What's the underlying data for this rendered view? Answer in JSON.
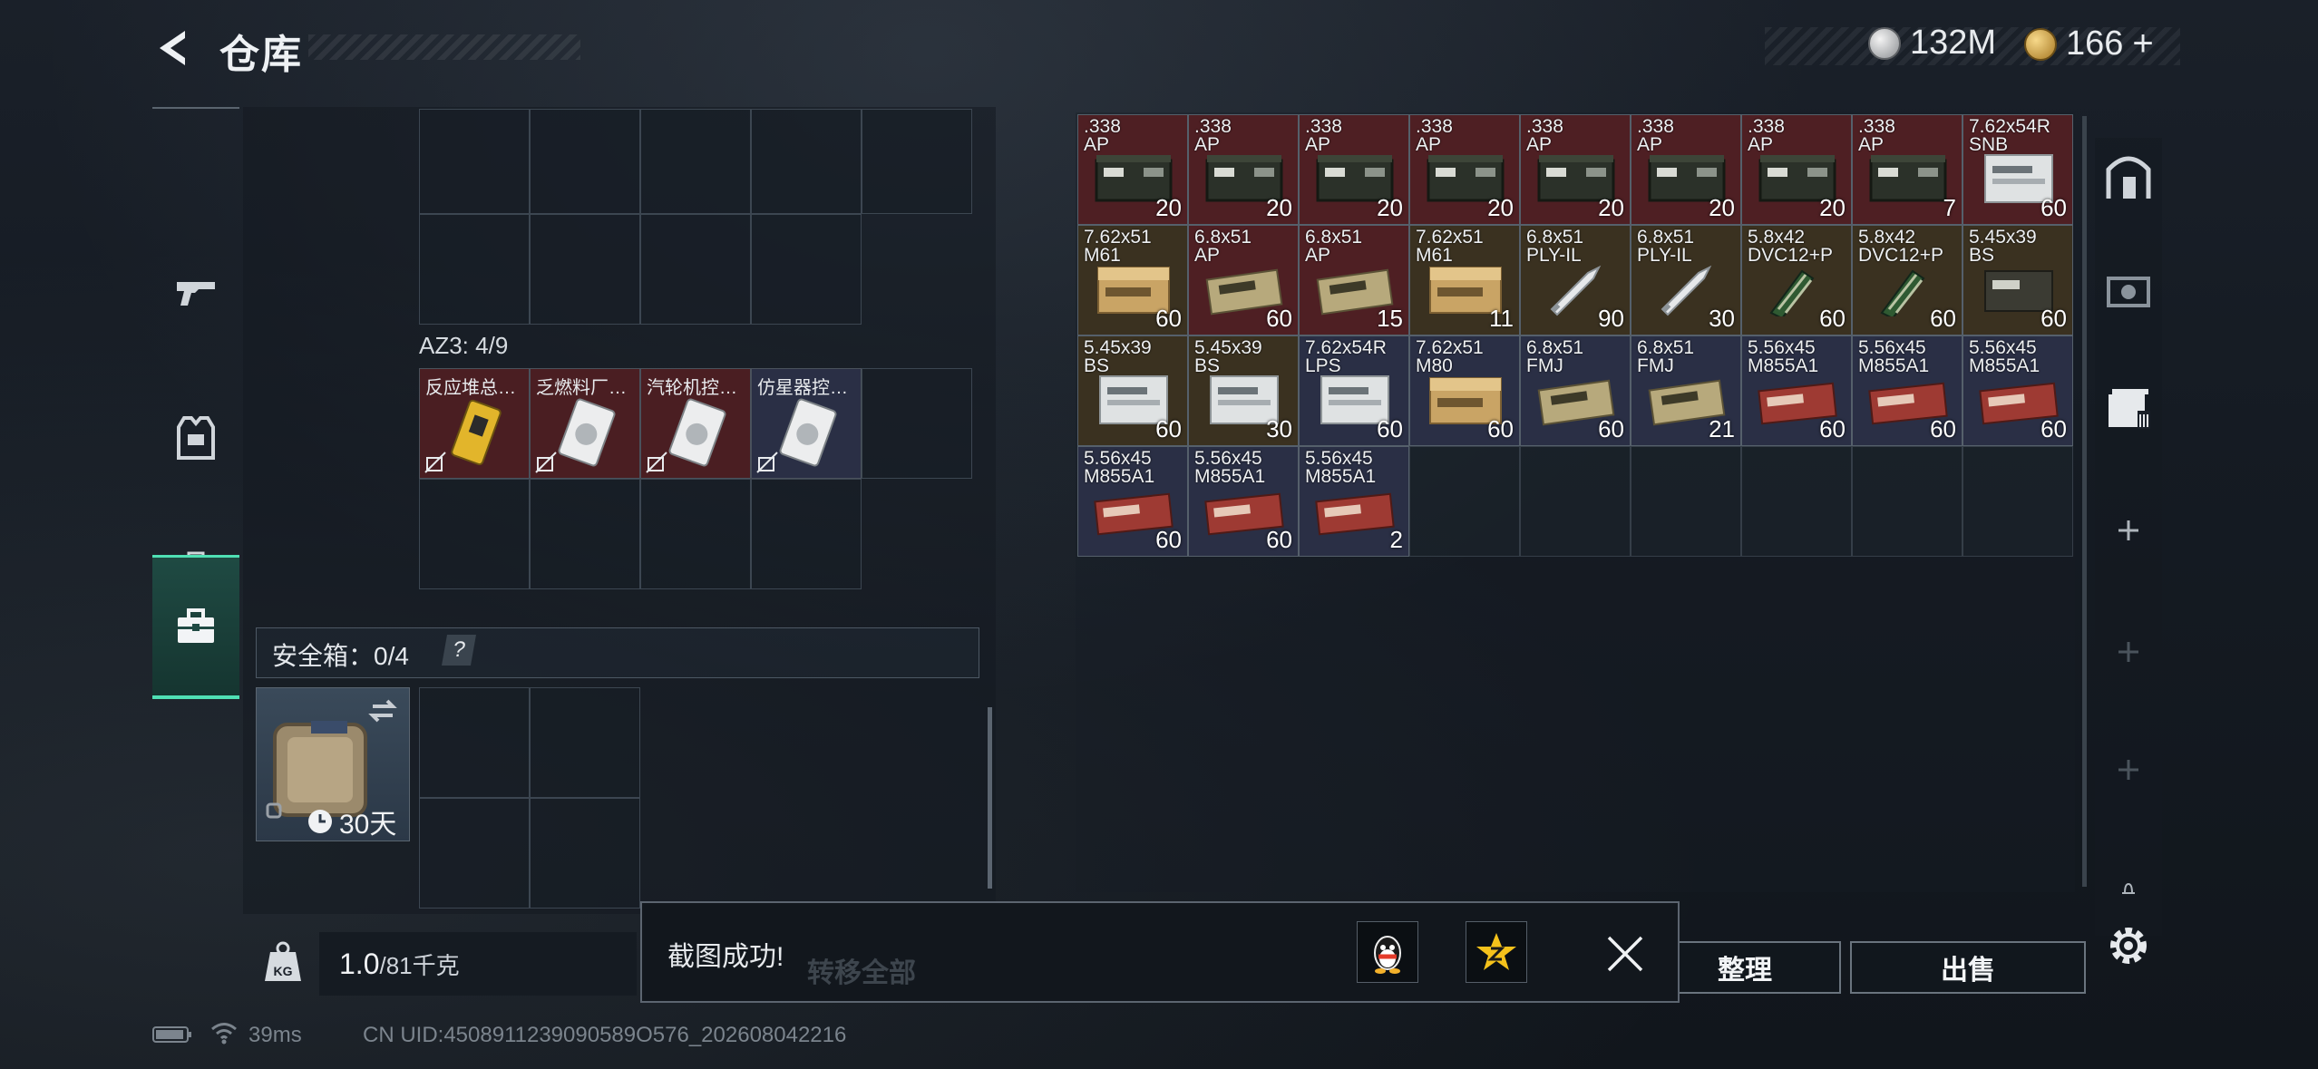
{
  "header": {
    "title": "仓库",
    "currency_silver": "132M",
    "currency_gold": "166",
    "add_symbol": "+"
  },
  "sidebar": {
    "tabs": [
      {
        "icon": "pistol-icon"
      },
      {
        "icon": "vest-icon"
      },
      {
        "icon": "backpack-icon"
      },
      {
        "icon": "briefcase-icon",
        "active": true
      }
    ]
  },
  "left": {
    "container_label": "AZ3: 4/9",
    "container_items": [
      {
        "name": "反应堆总…",
        "color": "#4a1e22",
        "pic": "yellow"
      },
      {
        "name": "乏燃料厂…",
        "color": "#4a1e22",
        "pic": "white"
      },
      {
        "name": "汽轮机控…",
        "color": "#4a1e22",
        "pic": "white"
      },
      {
        "name": "仿星器控…",
        "color": "#2a2f45",
        "pic": "white"
      }
    ],
    "safe_label": "安全箱：0/4",
    "safe_help": "?",
    "safe_days": "30天"
  },
  "weight": {
    "current": "1.0",
    "max": "/81千克"
  },
  "stash": {
    "items": [
      {
        "l1": ".338",
        "l2": "AP",
        "q": "20",
        "bg": "#4e1f23",
        "pic": "crate"
      },
      {
        "l1": ".338",
        "l2": "AP",
        "q": "20",
        "bg": "#4e1f23",
        "pic": "crate"
      },
      {
        "l1": ".338",
        "l2": "AP",
        "q": "20",
        "bg": "#4e1f23",
        "pic": "crate"
      },
      {
        "l1": ".338",
        "l2": "AP",
        "q": "20",
        "bg": "#4e1f23",
        "pic": "crate"
      },
      {
        "l1": ".338",
        "l2": "AP",
        "q": "20",
        "bg": "#4e1f23",
        "pic": "crate"
      },
      {
        "l1": ".338",
        "l2": "AP",
        "q": "20",
        "bg": "#4e1f23",
        "pic": "crate"
      },
      {
        "l1": ".338",
        "l2": "AP",
        "q": "20",
        "bg": "#4e1f23",
        "pic": "crate"
      },
      {
        "l1": ".338",
        "l2": "AP",
        "q": "7",
        "bg": "#4e1f23",
        "pic": "crate"
      },
      {
        "l1": "7.62x54R",
        "l2": "SNB",
        "q": "60",
        "bg": "#4e1f23",
        "pic": "whitebox"
      },
      {
        "l1": "7.62x51",
        "l2": "M61",
        "q": "60",
        "bg": "#3a3120",
        "pic": "tanbox"
      },
      {
        "l1": "6.8x51",
        "l2": "AP",
        "q": "60",
        "bg": "#4e1f23",
        "pic": "olivebox"
      },
      {
        "l1": "6.8x51",
        "l2": "AP",
        "q": "15",
        "bg": "#4e1f23",
        "pic": "olivebox"
      },
      {
        "l1": "7.62x51",
        "l2": "M61",
        "q": "11",
        "bg": "#3a3120",
        "pic": "tanbox"
      },
      {
        "l1": "6.8x51",
        "l2": "PLY-IL",
        "q": "90",
        "bg": "#3a3120",
        "pic": "bullet"
      },
      {
        "l1": "6.8x51",
        "l2": "PLY-IL",
        "q": "30",
        "bg": "#3a3120",
        "pic": "bullet"
      },
      {
        "l1": "5.8x42",
        "l2": "DVC12+P",
        "q": "60",
        "bg": "#3a3120",
        "pic": "greenclip"
      },
      {
        "l1": "5.8x42",
        "l2": "DVC12+P",
        "q": "60",
        "bg": "#3a3120",
        "pic": "greenclip"
      },
      {
        "l1": "5.45x39",
        "l2": "BS",
        "q": "60",
        "bg": "#3a3120",
        "pic": "darkbox"
      },
      {
        "l1": "5.45x39",
        "l2": "BS",
        "q": "60",
        "bg": "#3a3120",
        "pic": "whitebox"
      },
      {
        "l1": "5.45x39",
        "l2": "BS",
        "q": "30",
        "bg": "#3a3120",
        "pic": "whitebox"
      },
      {
        "l1": "7.62x54R",
        "l2": "LPS",
        "q": "60",
        "bg": "#2a2f45",
        "pic": "whitebox"
      },
      {
        "l1": "7.62x51",
        "l2": "M80",
        "q": "60",
        "bg": "#2a2f45",
        "pic": "tanbox"
      },
      {
        "l1": "6.8x51",
        "l2": "FMJ",
        "q": "60",
        "bg": "#2a2f45",
        "pic": "olivebox"
      },
      {
        "l1": "6.8x51",
        "l2": "FMJ",
        "q": "21",
        "bg": "#2a2f45",
        "pic": "olivebox"
      },
      {
        "l1": "5.56x45",
        "l2": "M855A1",
        "q": "60",
        "bg": "#2a2f45",
        "pic": "redbox"
      },
      {
        "l1": "5.56x45",
        "l2": "M855A1",
        "q": "60",
        "bg": "#2a2f45",
        "pic": "redbox"
      },
      {
        "l1": "5.56x45",
        "l2": "M855A1",
        "q": "60",
        "bg": "#2a2f45",
        "pic": "redbox"
      },
      {
        "l1": "5.56x45",
        "l2": "M855A1",
        "q": "60",
        "bg": "#2a2f45",
        "pic": "redbox"
      },
      {
        "l1": "5.56x45",
        "l2": "M855A1",
        "q": "60",
        "bg": "#2a2f45",
        "pic": "redbox"
      },
      {
        "l1": "5.56x45",
        "l2": "M855A1",
        "q": "2",
        "bg": "#2a2f45",
        "pic": "redbox"
      }
    ]
  },
  "buttons": {
    "transfer_all": "转移全部",
    "sort": "整理",
    "sell": "出售"
  },
  "toast": {
    "text": "截图成功!"
  },
  "status": {
    "ping": "39ms",
    "uid": "CN UID:4508911239090589O576_202608042216"
  },
  "colors": {
    "accent": "#4fe0b4",
    "rare_red": "#4e1f23",
    "rare_gold": "#3a3120",
    "rare_blue": "#2a2f45"
  }
}
